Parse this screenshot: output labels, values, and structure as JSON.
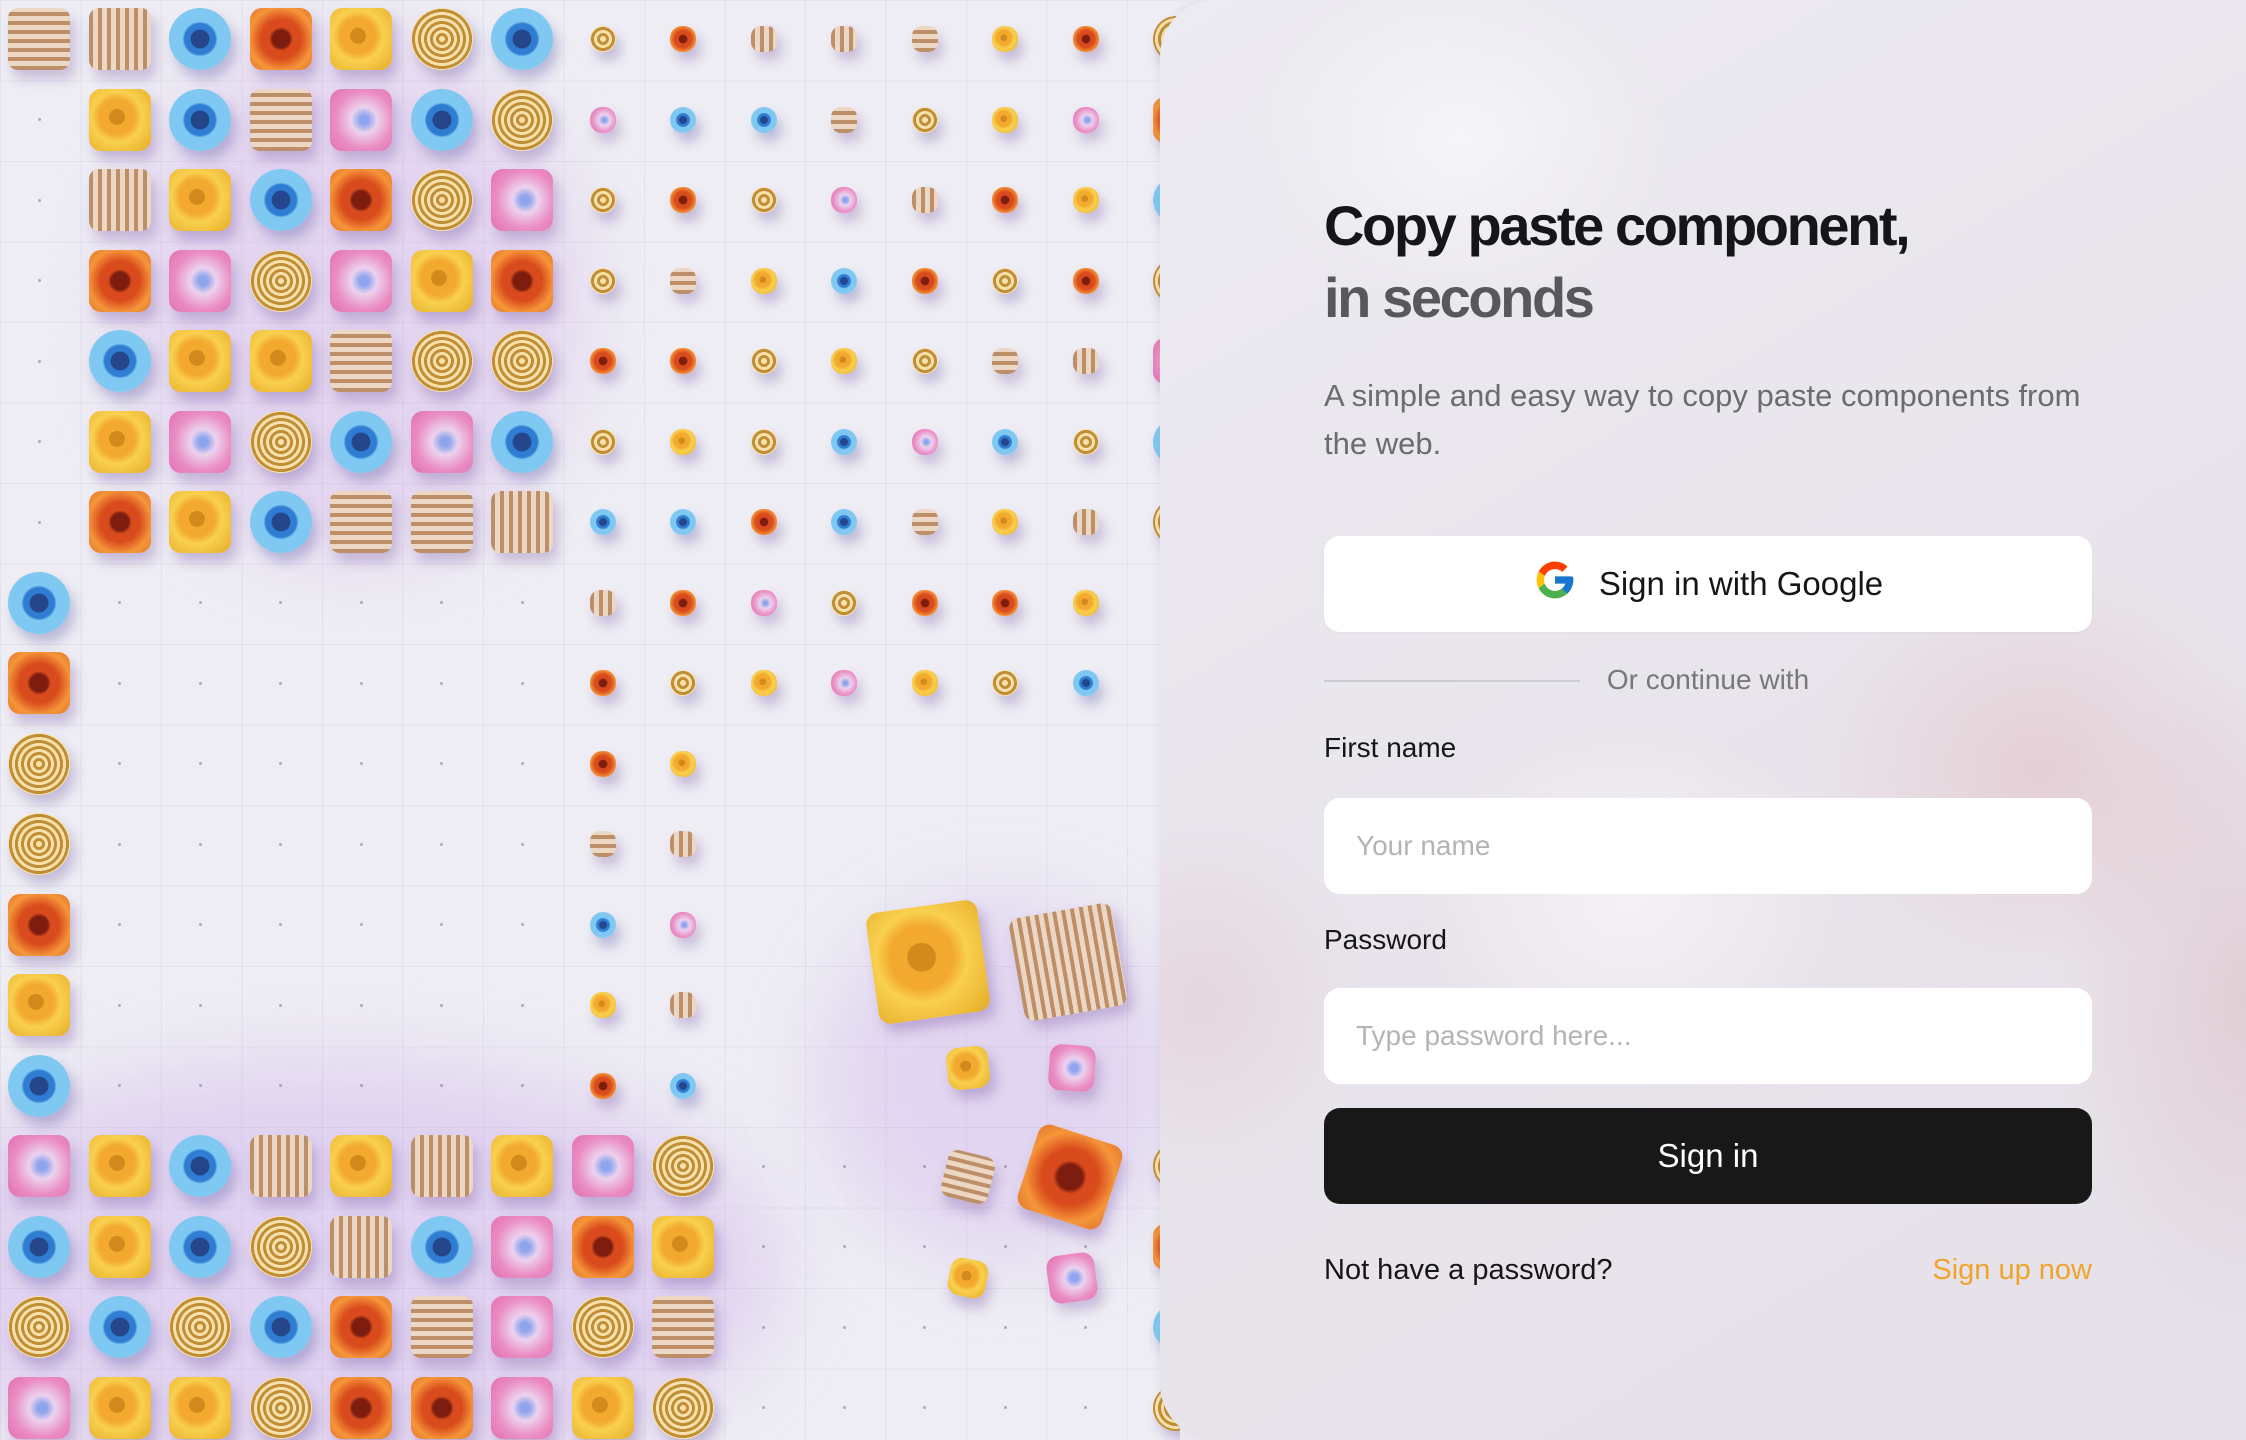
{
  "colors": {
    "accent_link": "#f0a42c",
    "primary_button": "#181818",
    "panel_background": "#ecebf1"
  },
  "decor": {
    "icon": "colorful-tiles-pattern"
  },
  "hero": {
    "title_line1": "Copy paste component,",
    "title_line2": "in seconds",
    "subtitle": "A simple and easy way to copy paste components from the web."
  },
  "auth": {
    "google_button_label": "Sign in with Google",
    "google_icon": "google-g-logo",
    "divider_text": "Or continue with",
    "first_name_label": "First name",
    "first_name_placeholder": "Your name",
    "first_name_value": "",
    "password_label": "Password",
    "password_placeholder": "Type password here...",
    "password_value": "",
    "submit_label": "Sign in"
  },
  "footer": {
    "question": "Not have a password?",
    "signup_link": "Sign up now"
  }
}
